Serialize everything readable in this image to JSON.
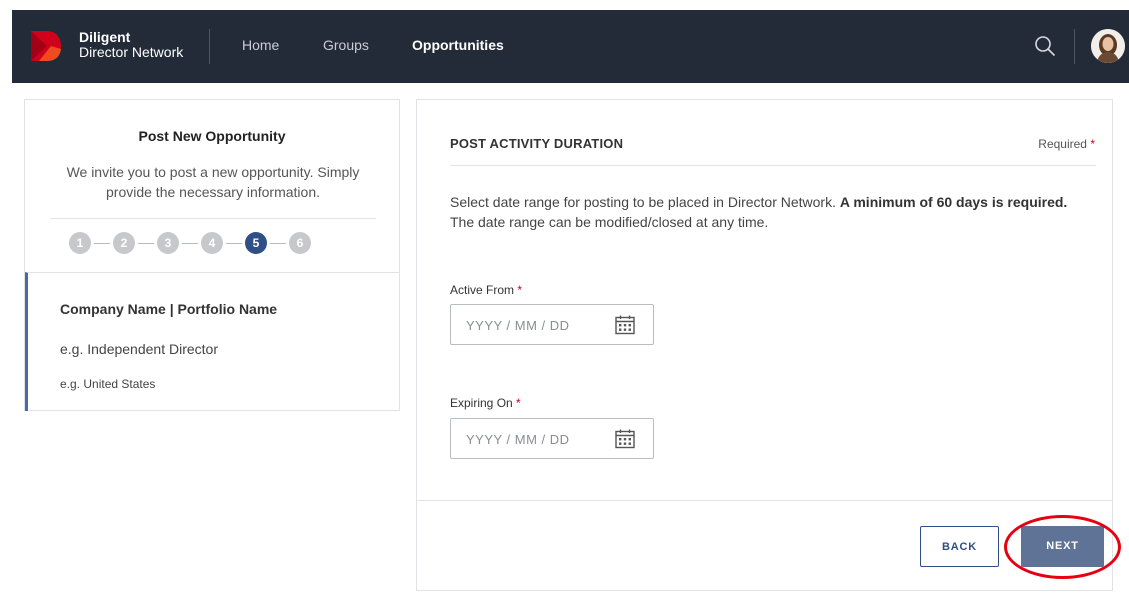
{
  "nav": {
    "brand_line1": "Diligent",
    "brand_line2": "Director Network",
    "items": [
      {
        "label": "Home",
        "active": false
      },
      {
        "label": "Groups",
        "active": false
      },
      {
        "label": "Opportunities",
        "active": true
      }
    ],
    "icons": {
      "search": "search-icon",
      "avatar": "user-avatar"
    }
  },
  "left_panel": {
    "title": "Post New Opportunity",
    "description": "We invite you to post a new opportunity. Simply provide the necessary information.",
    "steps": [
      "1",
      "2",
      "3",
      "4",
      "5",
      "6"
    ],
    "active_step": "5",
    "company": "Company Name | Portfolio Name",
    "role": "e.g. Independent Director",
    "location": "e.g. United States"
  },
  "right_panel": {
    "heading": "POST ACTIVITY DURATION",
    "required_label": "Required",
    "required_star": "*",
    "instruction_part1": "Select date range for posting to be placed in Director Network.",
    "instruction_bold": "A minimum of 60 days is required.",
    "instruction_part2": "The date range can be modified/closed at any time.",
    "active_from": {
      "label": "Active From",
      "star": "*",
      "placeholder": "YYYY  /  MM /  DD"
    },
    "expiring_on": {
      "label": "Expiring On",
      "star": "*",
      "placeholder": "YYYY  /  MM /  DD"
    }
  },
  "buttons": {
    "back": "BACK",
    "next": "NEXT"
  },
  "colors": {
    "nav_bg": "#232b39",
    "accent": "#2f4f86",
    "next_button": "#5f7396",
    "highlight": "#e60012",
    "required": "#d0021b"
  }
}
